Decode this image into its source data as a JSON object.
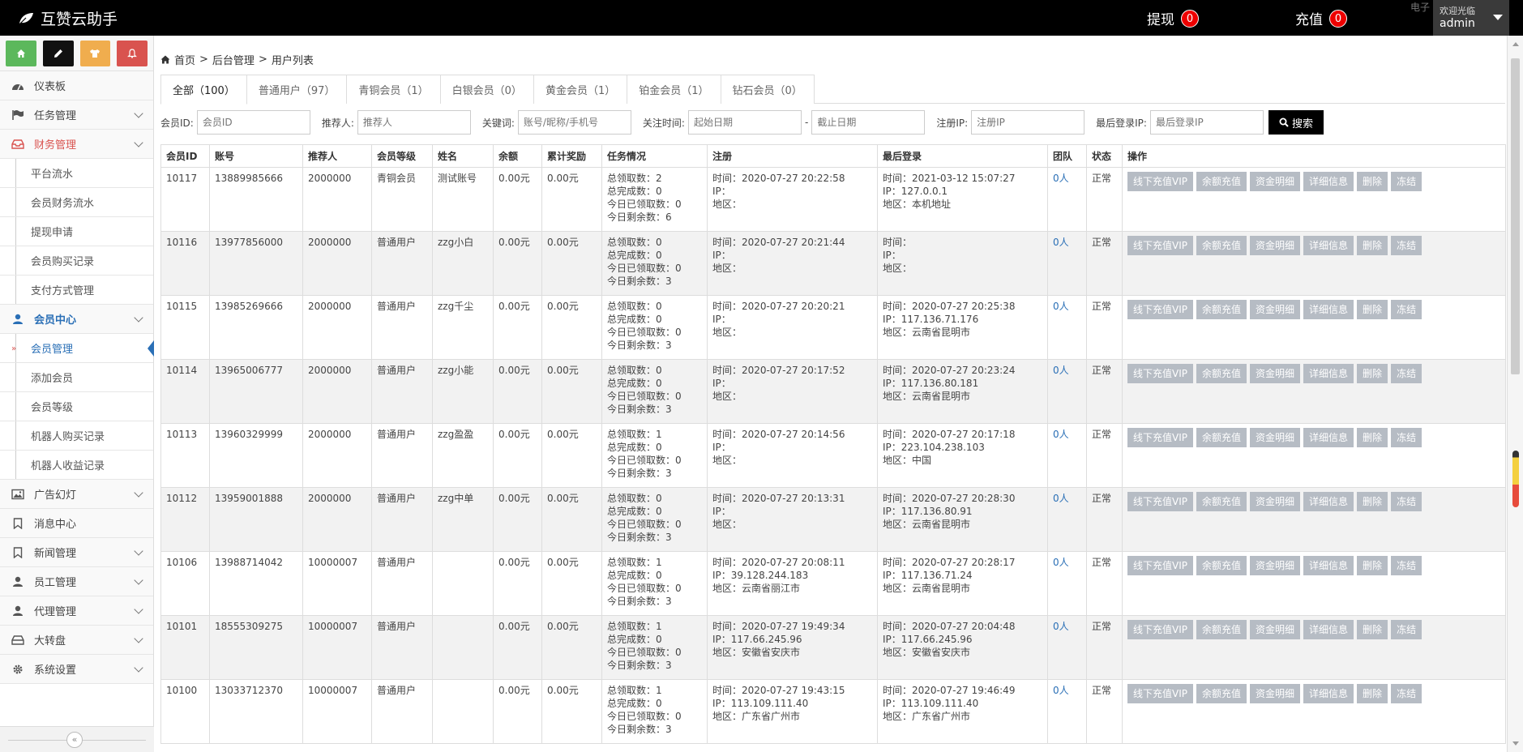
{
  "app": {
    "title": "互赞云助手"
  },
  "topbar": {
    "withdraw_label": "提现",
    "withdraw_count": "0",
    "recharge_label": "充值",
    "recharge_count": "0",
    "welcome": "欢迎光临",
    "username": "admin",
    "faded": "电子"
  },
  "sidebar": {
    "shortcut_colors": [
      "#5cb85c",
      "#111111",
      "#f0ad4e",
      "#d9534f"
    ],
    "items": [
      {
        "label": "仪表板",
        "icon": "dashboard-icon"
      },
      {
        "label": "任务管理",
        "icon": "flag-icon"
      },
      {
        "label": "财务管理",
        "icon": "inbox-icon"
      },
      {
        "label": "平台流水"
      },
      {
        "label": "会员财务流水"
      },
      {
        "label": "提现申请"
      },
      {
        "label": "会员购买记录"
      },
      {
        "label": "支付方式管理"
      },
      {
        "label": "会员中心",
        "icon": "user-icon"
      },
      {
        "label": "会员管理"
      },
      {
        "label": "添加会员"
      },
      {
        "label": "会员等级"
      },
      {
        "label": "机器人购买记录"
      },
      {
        "label": "机器人收益记录"
      },
      {
        "label": "广告幻灯",
        "icon": "image-icon"
      },
      {
        "label": "消息中心",
        "icon": "bookmark-icon"
      },
      {
        "label": "新闻管理",
        "icon": "bookmark-icon"
      },
      {
        "label": "员工管理",
        "icon": "user-icon"
      },
      {
        "label": "代理管理",
        "icon": "user-icon"
      },
      {
        "label": "大转盘",
        "icon": "inbox-icon"
      },
      {
        "label": "系统设置",
        "icon": "gear-icon"
      }
    ]
  },
  "breadcrumb": {
    "home": "首页",
    "sep": ">",
    "level2": "后台管理",
    "level3": "用户列表"
  },
  "tabs": [
    {
      "label": "全部（100）"
    },
    {
      "label": "普通用户（97）"
    },
    {
      "label": "青铜会员（1）"
    },
    {
      "label": "白银会员（0）"
    },
    {
      "label": "黄金会员（1）"
    },
    {
      "label": "铂金会员（1）"
    },
    {
      "label": "钻石会员（0）"
    }
  ],
  "filters": {
    "member_id_label": "会员ID:",
    "member_id_ph": "会员ID",
    "referrer_label": "推荐人:",
    "referrer_ph": "推荐人",
    "keyword_label": "关键词:",
    "keyword_ph": "账号/昵称/手机号",
    "time_label": "关注时间:",
    "start_ph": "起始日期",
    "dash": "-",
    "end_ph": "截止日期",
    "regip_label": "注册IP:",
    "regip_ph": "注册IP",
    "lastip_label": "最后登录IP:",
    "lastip_ph": "最后登录IP",
    "search_label": "搜索"
  },
  "table": {
    "headers": [
      "会员ID",
      "账号",
      "推荐人",
      "会员等级",
      "姓名",
      "余额",
      "累计奖励",
      "任务情况",
      "注册",
      "最后登录",
      "团队",
      "状态",
      "操作"
    ],
    "ops": [
      "线下充值VIP",
      "余额充值",
      "资金明细",
      "详细信息",
      "删除",
      "冻结"
    ],
    "rows": [
      {
        "id": "10117",
        "account": "13889985666",
        "ref": "2000000",
        "level": "青铜会员",
        "name": "测试账号",
        "balance": "0.00元",
        "reward": "0.00元",
        "task": [
          "总领取数：2",
          "总完成数：0",
          "今日已领取数：0",
          "今日剩余数：6"
        ],
        "reg": [
          "时间：2020-07-27 20:22:58",
          "IP：",
          "地区："
        ],
        "last": [
          "时间：2021-03-12 15:07:27",
          "IP：127.0.0.1",
          "地区：本机地址"
        ],
        "team": "0人",
        "status": "正常"
      },
      {
        "id": "10116",
        "account": "13977856000",
        "ref": "2000000",
        "level": "普通用户",
        "name": "zzg小白",
        "balance": "0.00元",
        "reward": "0.00元",
        "task": [
          "总领取数：0",
          "总完成数：0",
          "今日已领取数：0",
          "今日剩余数：3"
        ],
        "reg": [
          "时间：2020-07-27 20:21:44",
          "IP：",
          "地区："
        ],
        "last": [
          "时间：",
          "IP：",
          "地区："
        ],
        "team": "0人",
        "status": "正常"
      },
      {
        "id": "10115",
        "account": "13985269666",
        "ref": "2000000",
        "level": "普通用户",
        "name": "zzg千尘",
        "balance": "0.00元",
        "reward": "0.00元",
        "task": [
          "总领取数：0",
          "总完成数：0",
          "今日已领取数：0",
          "今日剩余数：3"
        ],
        "reg": [
          "时间：2020-07-27 20:20:21",
          "IP：",
          "地区："
        ],
        "last": [
          "时间：2020-07-27 20:25:38",
          "IP：117.136.71.176",
          "地区：云南省昆明市"
        ],
        "team": "0人",
        "status": "正常"
      },
      {
        "id": "10114",
        "account": "13965006777",
        "ref": "2000000",
        "level": "普通用户",
        "name": "zzg小能",
        "balance": "0.00元",
        "reward": "0.00元",
        "task": [
          "总领取数：0",
          "总完成数：0",
          "今日已领取数：0",
          "今日剩余数：3"
        ],
        "reg": [
          "时间：2020-07-27 20:17:52",
          "IP：",
          "地区："
        ],
        "last": [
          "时间：2020-07-27 20:23:24",
          "IP：117.136.80.181",
          "地区：云南省昆明市"
        ],
        "team": "0人",
        "status": "正常"
      },
      {
        "id": "10113",
        "account": "13960329999",
        "ref": "2000000",
        "level": "普通用户",
        "name": "zzg盈盈",
        "balance": "0.00元",
        "reward": "0.00元",
        "task": [
          "总领取数：1",
          "总完成数：0",
          "今日已领取数：0",
          "今日剩余数：3"
        ],
        "reg": [
          "时间：2020-07-27 20:14:56",
          "IP：",
          "地区："
        ],
        "last": [
          "时间：2020-07-27 20:17:18",
          "IP：223.104.238.103",
          "地区：中国"
        ],
        "team": "0人",
        "status": "正常"
      },
      {
        "id": "10112",
        "account": "13959001888",
        "ref": "2000000",
        "level": "普通用户",
        "name": "zzg中单",
        "balance": "0.00元",
        "reward": "0.00元",
        "task": [
          "总领取数：0",
          "总完成数：0",
          "今日已领取数：0",
          "今日剩余数：3"
        ],
        "reg": [
          "时间：2020-07-27 20:13:31",
          "IP：",
          "地区："
        ],
        "last": [
          "时间：2020-07-27 20:28:30",
          "IP：117.136.80.91",
          "地区：云南省昆明市"
        ],
        "team": "0人",
        "status": "正常"
      },
      {
        "id": "10106",
        "account": "13988714042",
        "ref": "10000007",
        "level": "普通用户",
        "name": "",
        "balance": "0.00元",
        "reward": "0.00元",
        "task": [
          "总领取数：1",
          "总完成数：0",
          "今日已领取数：0",
          "今日剩余数：3"
        ],
        "reg": [
          "时间：2020-07-27 20:08:11",
          "IP：39.128.244.183",
          "地区：云南省丽江市"
        ],
        "last": [
          "时间：2020-07-27 20:28:17",
          "IP：117.136.71.24",
          "地区：云南省昆明市"
        ],
        "team": "0人",
        "status": "正常"
      },
      {
        "id": "10101",
        "account": "18555309275",
        "ref": "10000007",
        "level": "普通用户",
        "name": "",
        "balance": "0.00元",
        "reward": "0.00元",
        "task": [
          "总领取数：1",
          "总完成数：0",
          "今日已领取数：0",
          "今日剩余数：3"
        ],
        "reg": [
          "时间：2020-07-27 19:49:34",
          "IP：117.66.245.96",
          "地区：安徽省安庆市"
        ],
        "last": [
          "时间：2020-07-27 20:04:48",
          "IP：117.66.245.96",
          "地区：安徽省安庆市"
        ],
        "team": "0人",
        "status": "正常"
      },
      {
        "id": "10100",
        "account": "13033712370",
        "ref": "10000007",
        "level": "普通用户",
        "name": "",
        "balance": "0.00元",
        "reward": "0.00元",
        "task": [
          "总领取数：1",
          "总完成数：0",
          "今日已领取数：0",
          "今日剩余数：3"
        ],
        "reg": [
          "时间：2020-07-27 19:43:15",
          "IP：113.109.111.40",
          "地区：广东省广州市"
        ],
        "last": [
          "时间：2020-07-27 19:46:49",
          "IP：113.109.111.40",
          "地区：广东省广州市"
        ],
        "team": "0人",
        "status": "正常"
      }
    ]
  }
}
